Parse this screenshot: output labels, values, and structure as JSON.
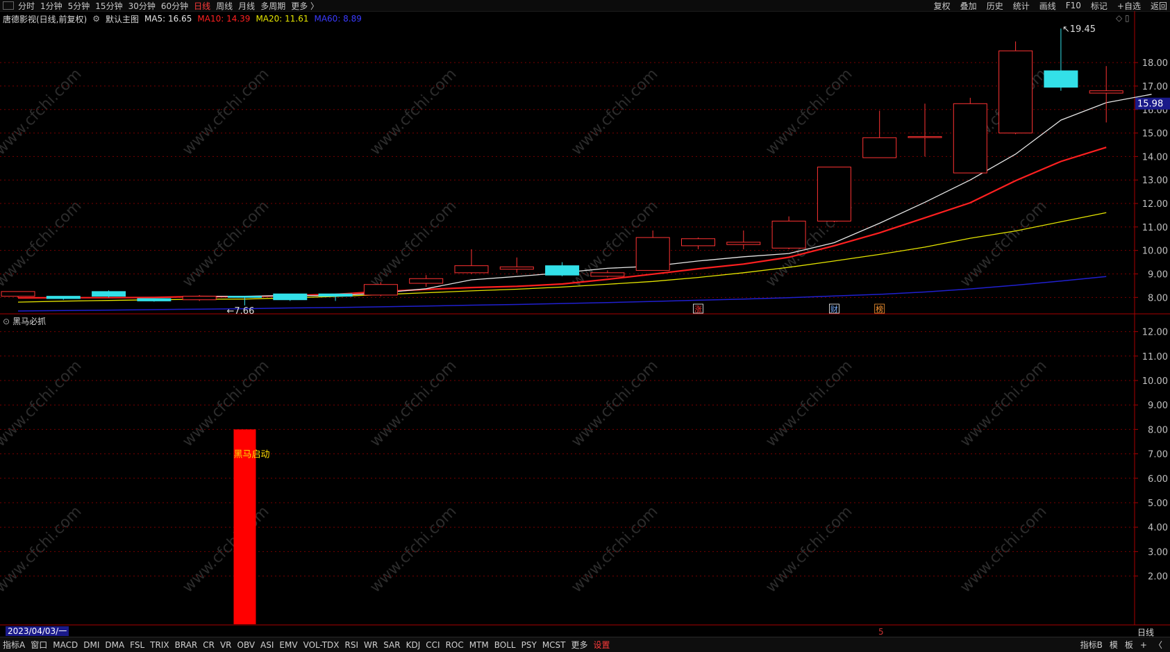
{
  "toolbar": {
    "left_items": [
      "分时",
      "1分钟",
      "5分钟",
      "15分钟",
      "30分钟",
      "60分钟",
      "日线",
      "周线",
      "月线",
      "多周期",
      "更多 〉"
    ],
    "active_item": "日线",
    "right_items": [
      "复权",
      "叠加",
      "历史",
      "统计",
      "画线",
      "F10",
      "标记",
      "+自选",
      "返回"
    ]
  },
  "main_panel": {
    "stock": "唐德影视(日线,前复权)",
    "template_name": "默认主图",
    "ma5_label": "MA5: 16.65",
    "ma10_label": "MA10: 14.39",
    "ma20_label": "MA20: 11.61",
    "ma60_label": "MA60: 8.89"
  },
  "sub_panel": {
    "indicator_name": "黑马必抓"
  },
  "colors": {
    "up": "#ff3333",
    "down": "#33e0e8",
    "ma5": "#e6e6e6",
    "ma10": "#ff2020",
    "ma20": "#e6e600",
    "ma60": "#2020d0",
    "signal": "#ff0000",
    "grid": "#7a0000"
  },
  "chart_data": [
    {
      "type": "candlestick",
      "title": "唐德影视(日线,前复权)",
      "y_ticks": [
        "8.00",
        "9.00",
        "10.00",
        "11.00",
        "12.00",
        "13.00",
        "14.00",
        "15.00",
        "16.00",
        "17.00",
        "18.00"
      ],
      "ylim": [
        7.3,
        19.6
      ],
      "current_price_label": "15.98",
      "high_annotation": "19.45",
      "low_annotation": "7.66",
      "candles": [
        {
          "open": 8.05,
          "close": 8.25,
          "high": 8.25,
          "low": 8.0
        },
        {
          "open": 8.05,
          "close": 7.95,
          "high": 8.05,
          "low": 7.9
        },
        {
          "open": 8.25,
          "close": 8.05,
          "high": 8.3,
          "low": 8.0
        },
        {
          "open": 7.95,
          "close": 7.85,
          "high": 7.95,
          "low": 7.82
        },
        {
          "open": 7.9,
          "close": 8.05,
          "high": 8.1,
          "low": 7.85
        },
        {
          "open": 8.05,
          "close": 8.0,
          "high": 8.05,
          "low": 7.66
        },
        {
          "open": 8.15,
          "close": 7.9,
          "high": 8.15,
          "low": 7.85
        },
        {
          "open": 8.15,
          "close": 8.05,
          "high": 8.15,
          "low": 7.85
        },
        {
          "open": 8.1,
          "close": 8.55,
          "high": 8.65,
          "low": 8.05
        },
        {
          "open": 8.6,
          "close": 8.8,
          "high": 8.95,
          "low": 8.45
        },
        {
          "open": 9.05,
          "close": 9.35,
          "high": 10.05,
          "low": 9.0
        },
        {
          "open": 9.2,
          "close": 9.3,
          "high": 9.7,
          "low": 9.05
        },
        {
          "open": 9.35,
          "close": 8.95,
          "high": 9.5,
          "low": 8.9
        },
        {
          "open": 8.9,
          "close": 9.05,
          "high": 9.15,
          "low": 8.85
        },
        {
          "open": 9.15,
          "close": 10.55,
          "high": 10.85,
          "low": 9.15
        },
        {
          "open": 10.2,
          "close": 10.5,
          "high": 10.55,
          "low": 10.05
        },
        {
          "open": 10.25,
          "close": 10.35,
          "high": 10.85,
          "low": 10.05
        },
        {
          "open": 10.1,
          "close": 11.25,
          "high": 11.45,
          "low": 10.05
        },
        {
          "open": 11.25,
          "close": 13.55,
          "high": 13.55,
          "low": 11.2
        },
        {
          "open": 13.95,
          "close": 14.8,
          "high": 15.95,
          "low": 13.95
        },
        {
          "open": 14.85,
          "close": 14.85,
          "high": 16.25,
          "low": 14.0
        },
        {
          "open": 13.3,
          "close": 16.25,
          "high": 16.5,
          "low": 13.3
        },
        {
          "open": 15.0,
          "close": 18.5,
          "high": 18.9,
          "low": 14.95
        },
        {
          "open": 17.65,
          "close": 16.95,
          "high": 19.45,
          "low": 16.8
        },
        {
          "open": 16.7,
          "close": 16.8,
          "high": 17.85,
          "low": 15.45
        }
      ],
      "ma5": [
        null,
        null,
        null,
        null,
        8.04,
        8.05,
        8.08,
        8.07,
        8.19,
        8.37,
        8.75,
        8.89,
        9.05,
        9.24,
        9.33,
        9.55,
        9.73,
        9.87,
        10.33,
        11.16,
        12.05,
        13.0,
        14.1,
        15.55,
        16.29,
        16.65
      ],
      "ma10": [
        7.98,
        7.99,
        7.99,
        8.0,
        8.04,
        8.03,
        8.08,
        8.13,
        8.25,
        8.34,
        8.42,
        8.47,
        8.57,
        8.77,
        8.99,
        9.22,
        9.42,
        9.71,
        10.2,
        10.75,
        11.39,
        12.03,
        12.97,
        13.79,
        14.39
      ],
      "ma20": [
        7.8,
        7.84,
        7.87,
        7.9,
        7.92,
        7.93,
        7.98,
        8.04,
        8.12,
        8.2,
        8.28,
        8.35,
        8.44,
        8.56,
        8.68,
        8.85,
        9.05,
        9.28,
        9.55,
        9.83,
        10.14,
        10.52,
        10.83,
        11.22,
        11.61
      ],
      "ma60": [
        7.42,
        7.44,
        7.46,
        7.48,
        7.5,
        7.52,
        7.55,
        7.57,
        7.6,
        7.63,
        7.67,
        7.7,
        7.74,
        7.78,
        7.83,
        7.88,
        7.93,
        7.99,
        8.06,
        8.13,
        8.23,
        8.36,
        8.52,
        8.7,
        8.89
      ],
      "event_markers": [
        {
          "index": 15,
          "label": "涨",
          "color": "#ff3333",
          "box": "#ffffff"
        },
        {
          "index": 18,
          "label": "财",
          "color": "#7ab0ff",
          "box": "#ffffff"
        },
        {
          "index": 19,
          "label": "榜",
          "color": "#ff9933",
          "box": "#ff9933"
        }
      ]
    },
    {
      "type": "bar",
      "title": "黑马必抓",
      "y_ticks": [
        "2.00",
        "3.00",
        "4.00",
        "5.00",
        "6.00",
        "7.00",
        "8.00",
        "9.00",
        "10.00",
        "11.00",
        "12.00"
      ],
      "ylim": [
        0,
        12.5
      ],
      "signal_index": 5,
      "signal_value": 8.0,
      "signal_label": "黑马启动"
    }
  ],
  "x_axis": {
    "date_label": "2023/04/03/一",
    "month_marker": "5",
    "period_label": "日线"
  },
  "watermark": "www.cfchi.com",
  "bottom_bar": {
    "left_items": [
      "指标A",
      "窗口",
      "MACD",
      "DMI",
      "DMA",
      "FSL",
      "TRIX",
      "BRAR",
      "CR",
      "VR",
      "OBV",
      "ASI",
      "EMV",
      "VOL-TDX",
      "RSI",
      "WR",
      "SAR",
      "KDJ",
      "CCI",
      "ROC",
      "MTM",
      "BOLL",
      "PSY",
      "MCST",
      "更多",
      "设置"
    ],
    "active_item": "设置",
    "right_items": [
      "指标B",
      "模",
      "板",
      "+",
      "〈"
    ]
  }
}
